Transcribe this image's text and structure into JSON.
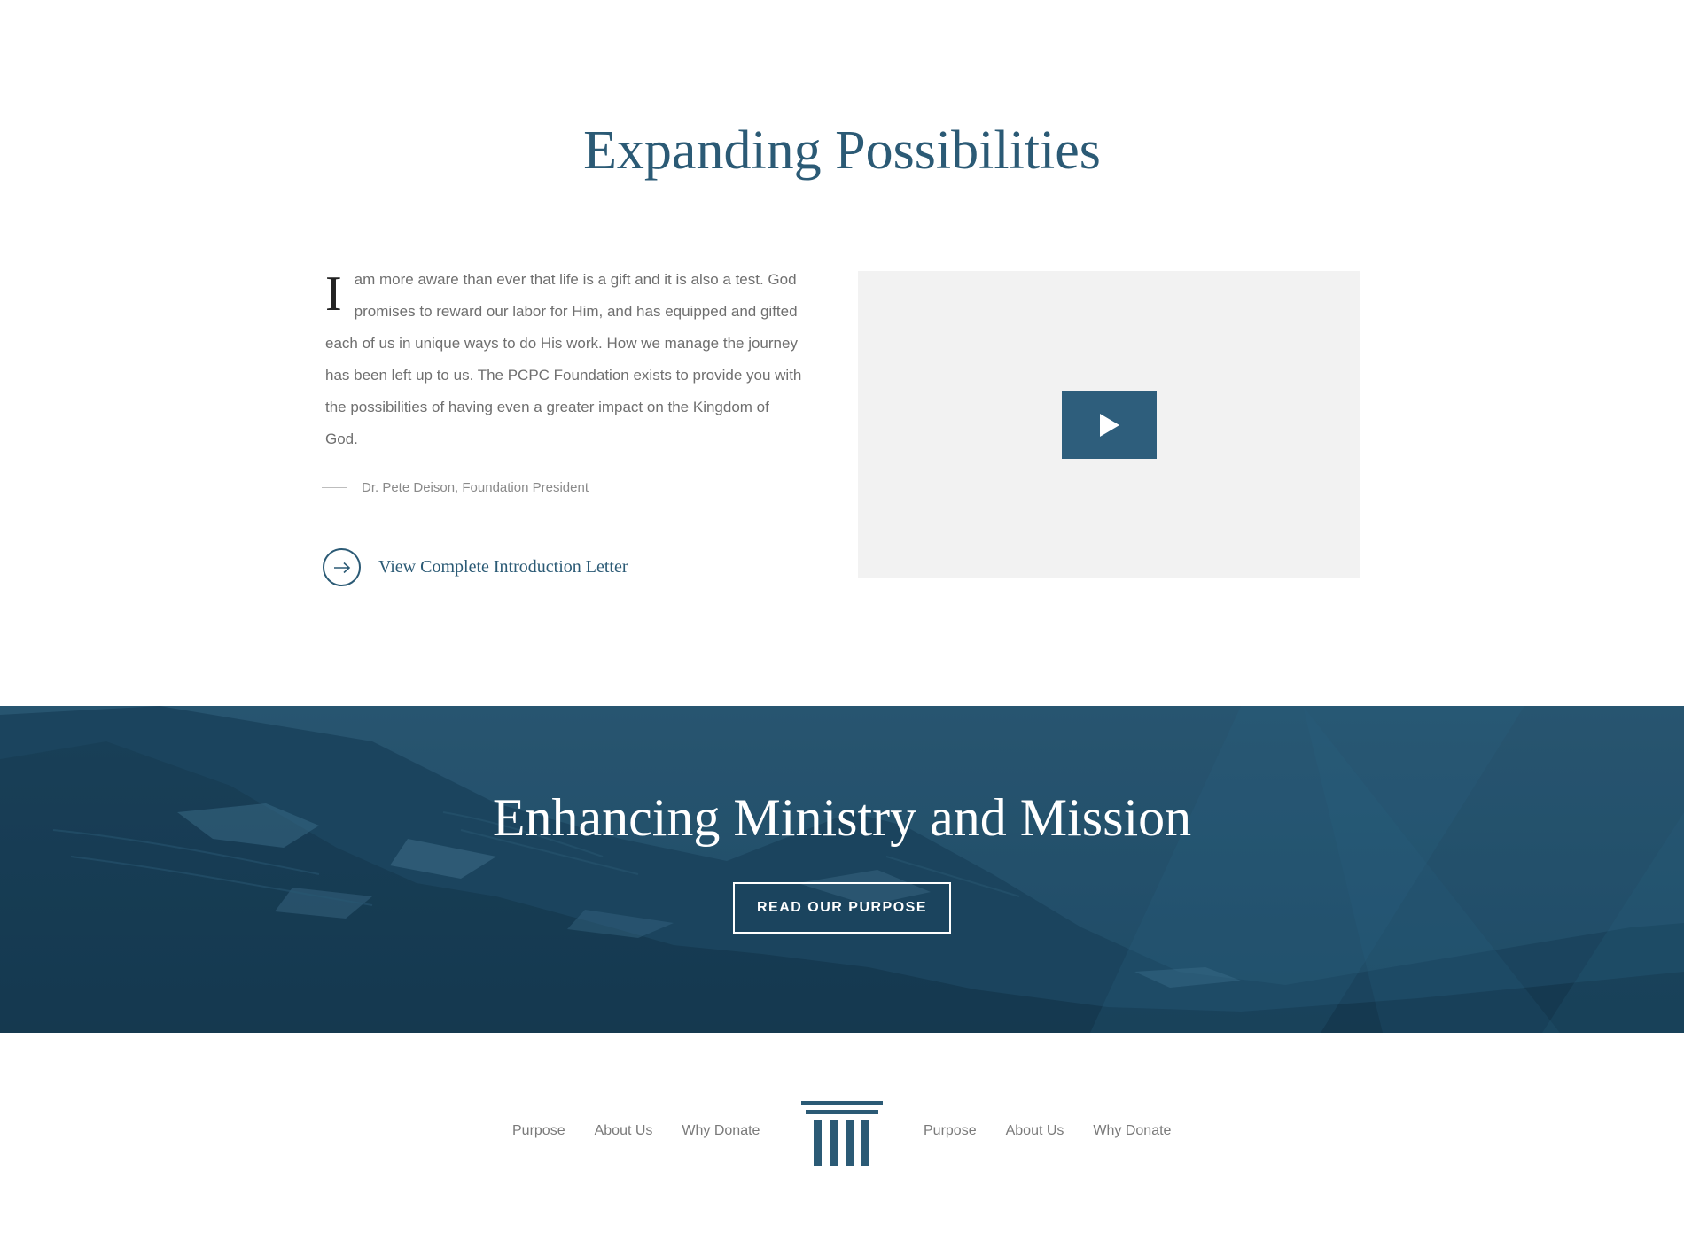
{
  "intro": {
    "title": "Expanding Possibilities",
    "letter_dropcap": "I",
    "letter_text": "am more aware than ever that life is a gift and it is also a test. God promises to reward our labor for Him, and has equipped and gifted each of us in unique ways to do His work. How we manage the journey has been left up to us. The PCPC Foundation exists to provide you with the possibilities of having even a greater impact on the Kingdom of God.",
    "attribution": "Dr. Pete Deison, Foundation President",
    "cta_label": "View Complete Introduction Letter",
    "cta_icon": "arrow-right-icon"
  },
  "video": {
    "play_icon": "play-icon"
  },
  "banner": {
    "title": "Enhancing Ministry and Mission",
    "button_label": "READ OUR PURPOSE"
  },
  "footer": {
    "nav_left": [
      "Purpose",
      "About Us",
      "Why Donate"
    ],
    "nav_right": [
      "Purpose",
      "About Us",
      "Why Donate"
    ],
    "logo_icon": "column-logo-icon"
  },
  "colors": {
    "brand": "#2b5a75",
    "banner": "#1d4a64",
    "video_bg": "#f2f2f2",
    "body_text": "#6f6f6f"
  }
}
